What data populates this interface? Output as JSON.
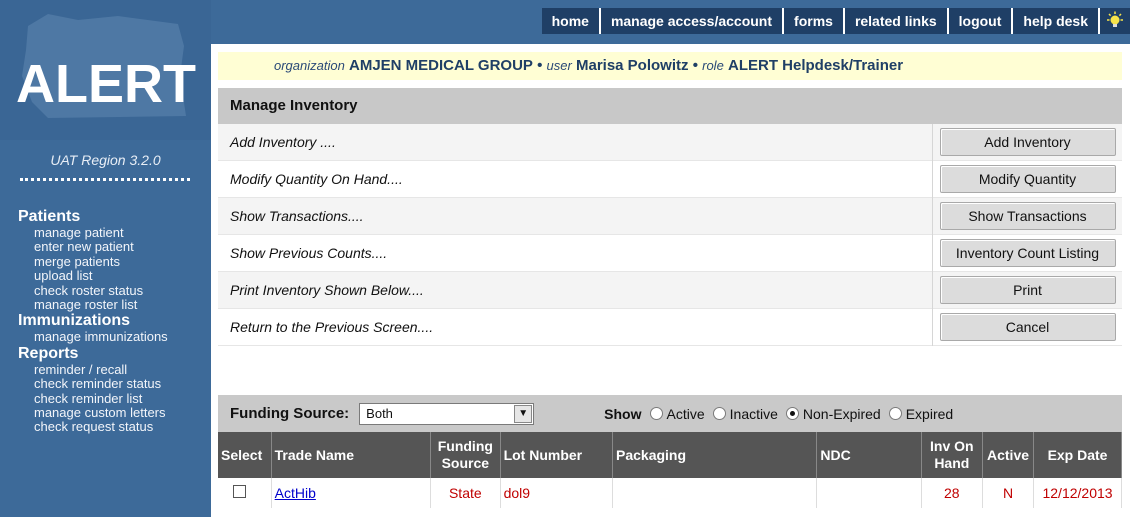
{
  "app": {
    "logo_text": "ALERT",
    "region": "UAT Region 3.2.0"
  },
  "topnav": [
    "home",
    "manage access/account",
    "forms",
    "related links",
    "logout",
    "help desk"
  ],
  "context": {
    "org_label": "organization",
    "org_value": "AMJEN MEDICAL GROUP",
    "user_label": "user",
    "user_value": "Marisa Polowitz",
    "role_label": "role",
    "role_value": "ALERT Helpdesk/Trainer",
    "separator": "•"
  },
  "sidebar": {
    "groups": [
      {
        "title": "Patients",
        "items": [
          "manage patient",
          "enter new patient",
          "merge patients",
          "upload list",
          "check roster status",
          "manage roster list"
        ]
      },
      {
        "title": "Immunizations",
        "items": [
          "manage immunizations"
        ]
      },
      {
        "title": "Reports",
        "items": [
          "reminder / recall",
          "check reminder status",
          "check reminder list",
          "manage custom letters",
          "check request status"
        ]
      }
    ]
  },
  "panel": {
    "title": "Manage Inventory",
    "rows": [
      {
        "label": "Add Inventory ....",
        "button": "Add Inventory"
      },
      {
        "label": "Modify Quantity On Hand....",
        "button": "Modify Quantity"
      },
      {
        "label": "Show Transactions....",
        "button": "Show Transactions"
      },
      {
        "label": "Show Previous Counts....",
        "button": "Inventory Count Listing"
      },
      {
        "label": "Print Inventory Shown Below....",
        "button": "Print"
      },
      {
        "label": "Return to the Previous Screen....",
        "button": "Cancel"
      }
    ]
  },
  "filter": {
    "funding_label": "Funding Source:",
    "funding_value": "Both",
    "show_label": "Show",
    "options": [
      {
        "label": "Active",
        "selected": false
      },
      {
        "label": "Inactive",
        "selected": false
      },
      {
        "label": "Non-Expired",
        "selected": true
      },
      {
        "label": "Expired",
        "selected": false
      }
    ]
  },
  "table": {
    "headers": [
      "Select",
      "Trade Name",
      "Funding Source",
      "Lot Number",
      "Packaging",
      "NDC",
      "Inv On Hand",
      "Active",
      "Exp Date"
    ],
    "rows": [
      {
        "trade_name": "ActHib",
        "funding": "State",
        "lot": "dol9",
        "packaging": "",
        "ndc": "",
        "inv": "28",
        "active": "N",
        "exp": "12/12/2013"
      }
    ]
  },
  "colors": {
    "sidebar": "#3d6a99",
    "nav_tab": "#1f3f66",
    "org_bar": "#fffed4",
    "table_header": "#555555",
    "row_text": "#c00000"
  }
}
